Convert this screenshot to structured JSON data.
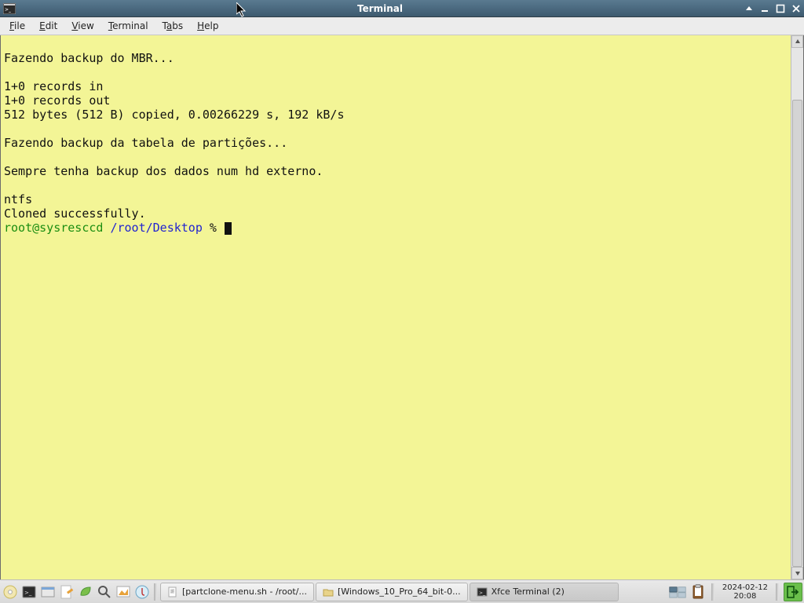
{
  "window": {
    "title": "Terminal"
  },
  "menubar": {
    "items": [
      {
        "accel": "F",
        "rest": "ile"
      },
      {
        "accel": "E",
        "rest": "dit"
      },
      {
        "accel": "V",
        "rest": "iew"
      },
      {
        "accel": "T",
        "rest": "erminal"
      },
      {
        "accel": "",
        "rest": "",
        "a2": "T",
        "b2": "a",
        "c2": "bs"
      },
      {
        "accel": "H",
        "rest": "elp"
      }
    ]
  },
  "terminal": {
    "lines": [
      "",
      "Fazendo backup do MBR...",
      "",
      "1+0 records in",
      "1+0 records out",
      "512 bytes (512 B) copied, 0.00266229 s, 192 kB/s",
      "",
      "Fazendo backup da tabela de partições...",
      "",
      "Sempre tenha backup dos dados num hd externo.",
      "",
      "ntfs",
      "Cloned successfully."
    ],
    "prompt": {
      "userhost": "root@sysresccd",
      "path": "/root/Desktop",
      "symbol": "%"
    }
  },
  "panel": {
    "tasks": [
      {
        "label": "[partclone-menu.sh - /root/..."
      },
      {
        "label": "[Windows_10_Pro_64_bit-0..."
      },
      {
        "label": "Xfce Terminal (2)"
      }
    ],
    "clock": {
      "date": "2024-02-12",
      "time": "20:08"
    }
  }
}
